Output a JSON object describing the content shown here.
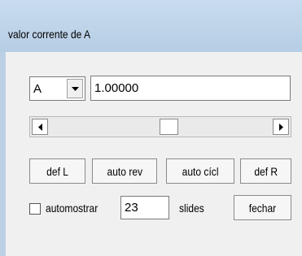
{
  "window": {
    "title": "valor corrente de A"
  },
  "parameter_select": {
    "value": "A"
  },
  "value_field": {
    "value": "1.00000"
  },
  "slider": {
    "min_fraction": 0,
    "position_fraction": 0.5
  },
  "buttons": {
    "def_l": "def L",
    "auto_rev": "auto rev",
    "auto_cicl": "auto cícl",
    "def_r": "def R",
    "fechar": "fechar"
  },
  "automostrar": {
    "label": "automostrar",
    "checked": false,
    "value": "23",
    "unit": "slides"
  },
  "icons": {
    "dropdown": "chevron-down-icon",
    "scroll_left": "arrow-left-icon",
    "scroll_right": "arrow-right-icon"
  }
}
